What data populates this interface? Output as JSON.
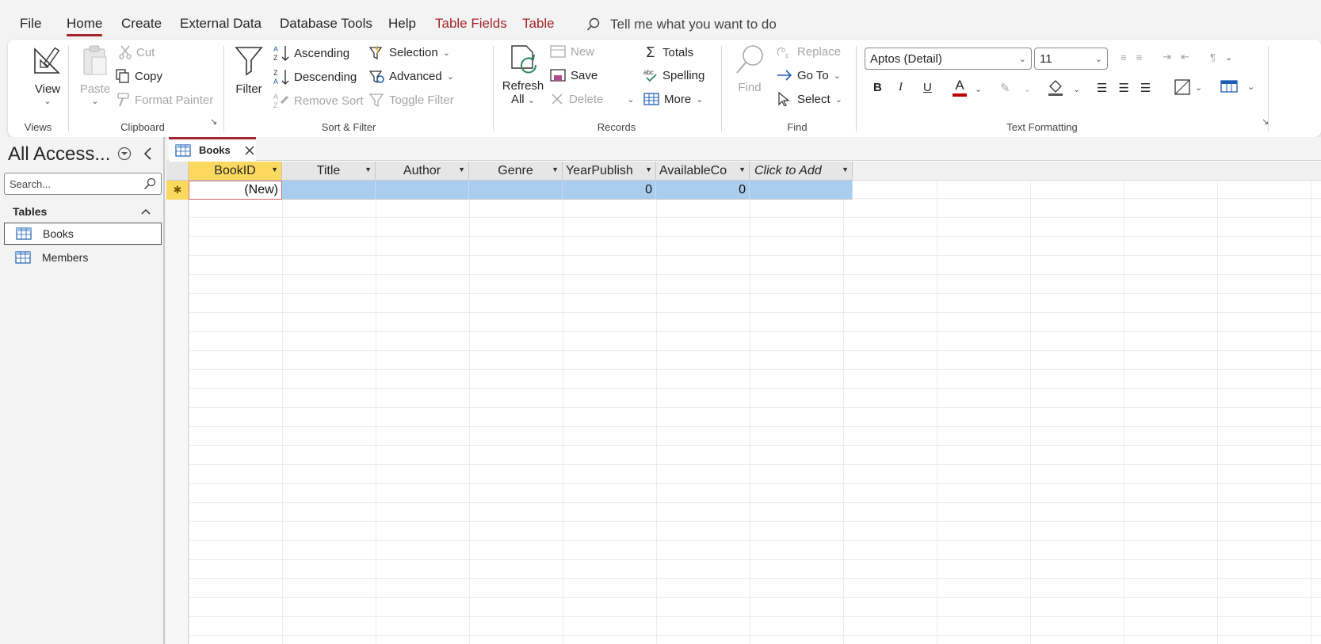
{
  "menu": {
    "tabs": [
      {
        "label": "File"
      },
      {
        "label": "Home"
      },
      {
        "label": "Create"
      },
      {
        "label": "External Data"
      },
      {
        "label": "Database Tools"
      },
      {
        "label": "Help"
      },
      {
        "label": "Table Fields"
      },
      {
        "label": "Table"
      }
    ],
    "tell_me": "Tell me what you want to do"
  },
  "ribbon": {
    "views": {
      "view": "View",
      "label": "Views"
    },
    "clipboard": {
      "paste": "Paste",
      "cut": "Cut",
      "copy": "Copy",
      "format_painter": "Format Painter",
      "label": "Clipboard"
    },
    "sort_filter": {
      "filter": "Filter",
      "ascending": "Ascending",
      "descending": "Descending",
      "remove_sort": "Remove Sort",
      "selection": "Selection",
      "advanced": "Advanced",
      "toggle_filter": "Toggle Filter",
      "label": "Sort & Filter"
    },
    "records": {
      "refresh": "Refresh",
      "refresh2": "All",
      "new": "New",
      "save": "Save",
      "delete": "Delete",
      "totals": "Totals",
      "spelling": "Spelling",
      "more": "More",
      "label": "Records"
    },
    "find": {
      "find": "Find",
      "replace": "Replace",
      "goto": "Go To",
      "select": "Select",
      "label": "Find"
    },
    "text_formatting": {
      "font": "Aptos (Detail)",
      "size": "11",
      "bold": "B",
      "italic": "I",
      "underline": "U",
      "label": "Text Formatting",
      "font_color": "#c00000"
    }
  },
  "nav": {
    "title": "All Access...",
    "search_placeholder": "Search...",
    "section": "Tables",
    "items": [
      {
        "label": "Books"
      },
      {
        "label": "Members"
      }
    ]
  },
  "document": {
    "tab": "Books",
    "columns": [
      "BookID",
      "Title",
      "Author",
      "Genre",
      "YearPublish",
      "AvailableCo",
      "Click to Add"
    ],
    "new_row": {
      "BookID": "(New)",
      "YearPublish": "0",
      "AvailableCo": "0"
    }
  }
}
